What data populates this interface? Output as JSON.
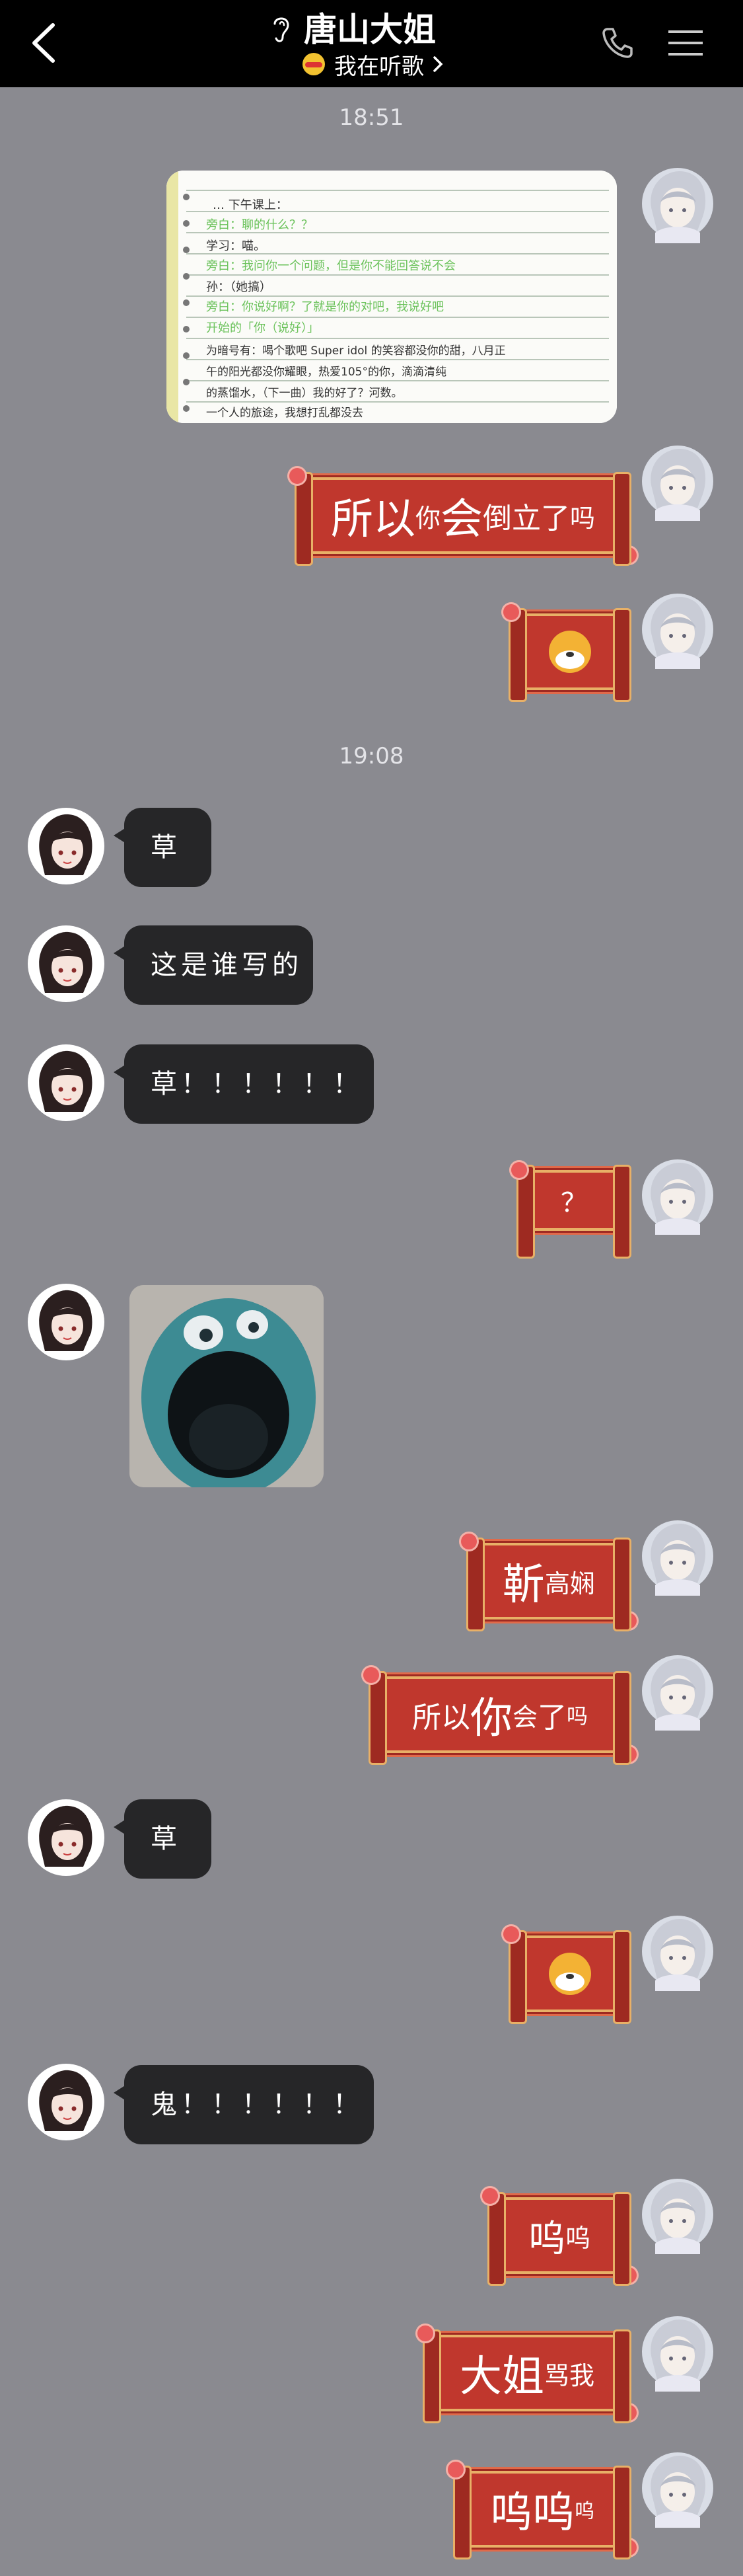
{
  "header": {
    "title": "唐山大姐",
    "listening": "我在听歌"
  },
  "colors": {
    "background": "#8a8a90",
    "header": "#000000",
    "incoming_bubble": "#262628",
    "scroll_red": "#c0372d",
    "scroll_gold": "#e8b067"
  },
  "timestamps": [
    "18:51",
    "19:08"
  ],
  "messages": {
    "m2_big1": "所以",
    "m2_small1": "你",
    "m2_big2": "会",
    "m2_big3": "倒立了",
    "m2_small2": "吗",
    "i1": "草",
    "i2": "这是谁写的",
    "i3": "草！！！！！！",
    "m4": "？",
    "m5_big": "靳",
    "m5_small": "高娴",
    "m6_a": "所以",
    "m6_big": "你",
    "m6_b": "会",
    "m6_c": "了",
    "m6_small": "吗",
    "i4": "草",
    "i5": "鬼！！！！！！",
    "m8_big": "呜",
    "m8_small": "呜",
    "m9_big": "大姐",
    "m9_small": "骂我",
    "m10_big": "呜呜",
    "m10_small": "呜"
  },
  "notebook": {
    "lines": [
      "… 下午课上：",
      "旁白：聊的什么？？",
      "学习：喵。",
      "旁白：我问你一个问题，但是你不能回答说不会",
      "孙：（她搞）",
      "旁白：你说好啊？了就是你的对吧，我说好吧",
      "开始的「你（说好）」",
      "为暗号有：喝个歌吧 Super idol 的笑容都没你的甜，八月正",
      "午的阳光都没你耀眼，热爱105°的你，滴滴清纯",
      "的蒸馏水，（下一曲）我的好了？河数。",
      "一个人的旅途，我想打乱都没去"
    ]
  },
  "icons": [
    "back-icon",
    "ear-icon",
    "face-emoji-icon",
    "chevron-right-icon",
    "phone-icon",
    "menu-icon",
    "dog-sticker-icon"
  ]
}
